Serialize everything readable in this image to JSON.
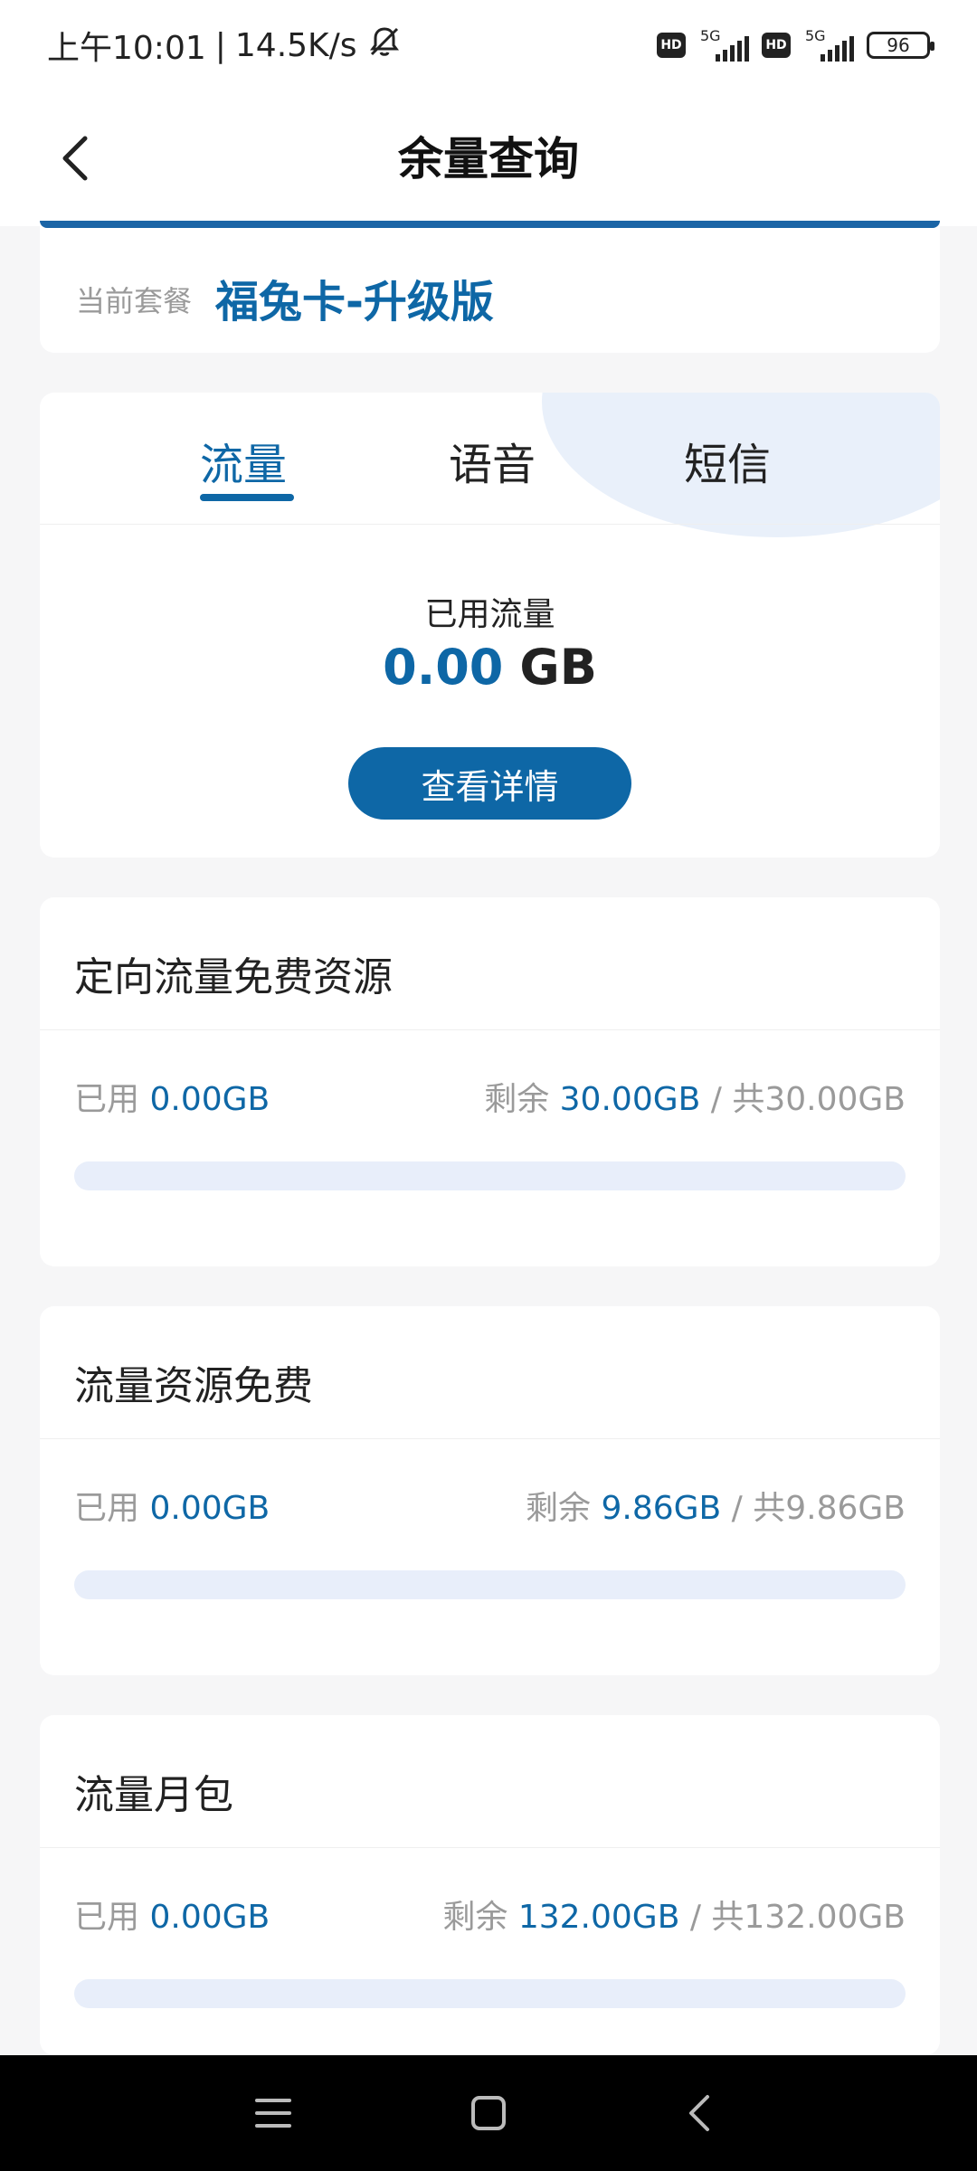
{
  "status_bar": {
    "time": "上午10:01",
    "net_speed": "14.5K/s",
    "hd_label": "HD",
    "network": "5G",
    "battery": "96"
  },
  "header": {
    "title": "余量查询"
  },
  "plan": {
    "label": "当前套餐",
    "name": "福兔卡-升级版"
  },
  "usage": {
    "tabs": [
      {
        "label": "流量",
        "active": true
      },
      {
        "label": "语音",
        "active": false
      },
      {
        "label": "短信",
        "active": false
      }
    ],
    "used_label": "已用流量",
    "used_value": "0.00",
    "used_unit": "GB",
    "detail_button": "查看详情"
  },
  "resources": [
    {
      "title": "定向流量免费资源",
      "used_prefix": "已用",
      "used": "0.00GB",
      "remain_prefix": "剩余",
      "remain": "30.00GB",
      "total": "/ 共30.00GB",
      "used_fraction": 0
    },
    {
      "title": "流量资源免费",
      "used_prefix": "已用",
      "used": "0.00GB",
      "remain_prefix": "剩余",
      "remain": "9.86GB",
      "total": "/ 共9.86GB",
      "used_fraction": 0
    },
    {
      "title": "流量月包",
      "used_prefix": "已用",
      "used": "0.00GB",
      "remain_prefix": "剩余",
      "remain": "132.00GB",
      "total": "/ 共132.00GB",
      "used_fraction": 0
    }
  ],
  "nav": {
    "icons": [
      "menu-icon",
      "home-square-icon",
      "back-chevron-icon"
    ]
  },
  "colors": {
    "accent": "#0e67a6",
    "bar_track": "#e8eefa",
    "muted_text": "#9a9a9a",
    "background": "#f6f6f7"
  }
}
